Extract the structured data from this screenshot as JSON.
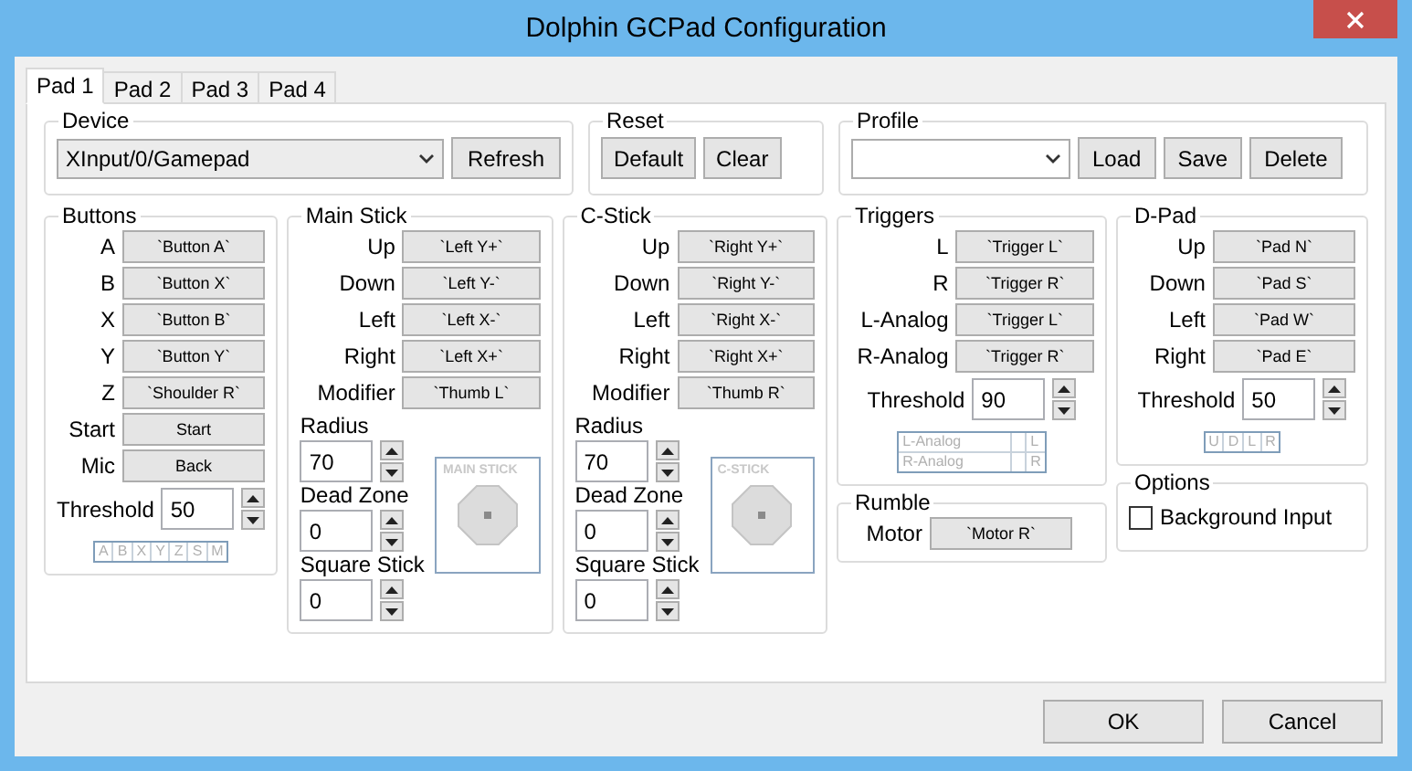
{
  "window": {
    "title": "Dolphin GCPad Configuration"
  },
  "tabs": [
    {
      "label": "Pad 1",
      "selected": true
    },
    {
      "label": "Pad 2",
      "selected": false
    },
    {
      "label": "Pad 3",
      "selected": false
    },
    {
      "label": "Pad 4",
      "selected": false
    }
  ],
  "device": {
    "title": "Device",
    "value": "XInput/0/Gamepad",
    "button": "Refresh"
  },
  "reset": {
    "title": "Reset",
    "buttons": [
      "Default",
      "Clear"
    ]
  },
  "profile": {
    "title": "Profile",
    "buttons": [
      "Load",
      "Save",
      "Delete"
    ]
  },
  "buttons_group": {
    "title": "Buttons",
    "rows": [
      {
        "label": "A",
        "binding": "`Button A`"
      },
      {
        "label": "B",
        "binding": "`Button X`"
      },
      {
        "label": "X",
        "binding": "`Button B`"
      },
      {
        "label": "Y",
        "binding": "`Button Y`"
      },
      {
        "label": "Z",
        "binding": "`Shoulder R`"
      },
      {
        "label": "Start",
        "binding": "Start"
      },
      {
        "label": "Mic",
        "binding": "Back"
      }
    ],
    "threshold_label": "Threshold",
    "threshold": "50",
    "indicators": [
      "A",
      "B",
      "X",
      "Y",
      "Z",
      "S",
      "M"
    ]
  },
  "sticks": [
    {
      "title": "Main Stick",
      "rows": [
        {
          "label": "Up",
          "binding": "`Left Y+`"
        },
        {
          "label": "Down",
          "binding": "`Left Y-`"
        },
        {
          "label": "Left",
          "binding": "`Left X-`"
        },
        {
          "label": "Right",
          "binding": "`Left X+`"
        },
        {
          "label": "Modifier",
          "binding": "`Thumb L`"
        }
      ],
      "settings": [
        {
          "label": "Radius",
          "value": "70"
        },
        {
          "label": "Dead Zone",
          "value": "0"
        },
        {
          "label": "Square Stick",
          "value": "0"
        }
      ],
      "preview_label": "MAIN STICK"
    },
    {
      "title": "C-Stick",
      "rows": [
        {
          "label": "Up",
          "binding": "`Right Y+`"
        },
        {
          "label": "Down",
          "binding": "`Right Y-`"
        },
        {
          "label": "Left",
          "binding": "`Right X-`"
        },
        {
          "label": "Right",
          "binding": "`Right X+`"
        },
        {
          "label": "Modifier",
          "binding": "`Thumb R`"
        }
      ],
      "settings": [
        {
          "label": "Radius",
          "value": "70"
        },
        {
          "label": "Dead Zone",
          "value": "0"
        },
        {
          "label": "Square Stick",
          "value": "0"
        }
      ],
      "preview_label": "C-STICK"
    }
  ],
  "triggers": {
    "title": "Triggers",
    "rows": [
      {
        "label": "L",
        "binding": "`Trigger L`"
      },
      {
        "label": "R",
        "binding": "`Trigger R`"
      },
      {
        "label": "L-Analog",
        "binding": "`Trigger L`"
      },
      {
        "label": "R-Analog",
        "binding": "`Trigger R`"
      }
    ],
    "threshold_label": "Threshold",
    "threshold": "90",
    "indicators": [
      {
        "label": "L-Analog",
        "key": "L"
      },
      {
        "label": "R-Analog",
        "key": "R"
      }
    ]
  },
  "rumble": {
    "title": "Rumble",
    "rows": [
      {
        "label": "Motor",
        "binding": "`Motor R`"
      }
    ]
  },
  "dpad": {
    "title": "D-Pad",
    "rows": [
      {
        "label": "Up",
        "binding": "`Pad N`"
      },
      {
        "label": "Down",
        "binding": "`Pad S`"
      },
      {
        "label": "Left",
        "binding": "`Pad W`"
      },
      {
        "label": "Right",
        "binding": "`Pad E`"
      }
    ],
    "threshold_label": "Threshold",
    "threshold": "50",
    "indicators": [
      "U",
      "D",
      "L",
      "R"
    ]
  },
  "options": {
    "title": "Options",
    "checkbox": {
      "label": "Background Input",
      "checked": false
    }
  },
  "footer": {
    "buttons": [
      "OK",
      "Cancel"
    ]
  }
}
